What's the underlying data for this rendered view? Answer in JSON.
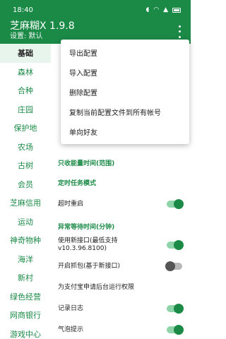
{
  "status_bar": {
    "time": "18:40",
    "icons": [
      "headset-icon",
      "wifi-icon",
      "signal-icon",
      "sim-icon",
      "battery-icon"
    ]
  },
  "app_bar": {
    "title": "芝麻糊X 1.9.8",
    "subtitle": "设置: 默认",
    "overflow_icon": "more-vertical-icon"
  },
  "sidebar": {
    "items": [
      {
        "label": "基础",
        "active": true
      },
      {
        "label": "森林"
      },
      {
        "label": "合种"
      },
      {
        "label": "庄园"
      },
      {
        "label": "保护地"
      },
      {
        "label": "农场"
      },
      {
        "label": "古树"
      },
      {
        "label": "会员"
      },
      {
        "label": "芝麻信用"
      },
      {
        "label": "运动"
      },
      {
        "label": "神奇物种"
      },
      {
        "label": "海洋"
      },
      {
        "label": "新村"
      },
      {
        "label": "绿色经营"
      },
      {
        "label": "网商银行"
      },
      {
        "label": "游戏中心"
      }
    ]
  },
  "main": {
    "section_only_collect": "只收能量时间(范围)",
    "section_timed_mode": "定时任务模式",
    "timeout_restart": "超时重启",
    "section_abnormal_wait": "异常等待时间(分钟)",
    "new_interface": "使用新接口(最低支持v10.3.96.8100)",
    "packet_capture": "开启抓包(基于新接口)",
    "alipay_background": "为支付宝申请后台运行权限",
    "record_log": "记录日志",
    "bubble_tip": "气泡提示"
  },
  "menu": {
    "items": [
      "导出配置",
      "导入配置",
      "删除配置",
      "复制当前配置文件到所有帐号",
      "单向好友"
    ]
  },
  "colors": {
    "primary": "#1b8a47",
    "accent": "#1b8a47",
    "toggle_on_track": "#8fd3a8"
  }
}
